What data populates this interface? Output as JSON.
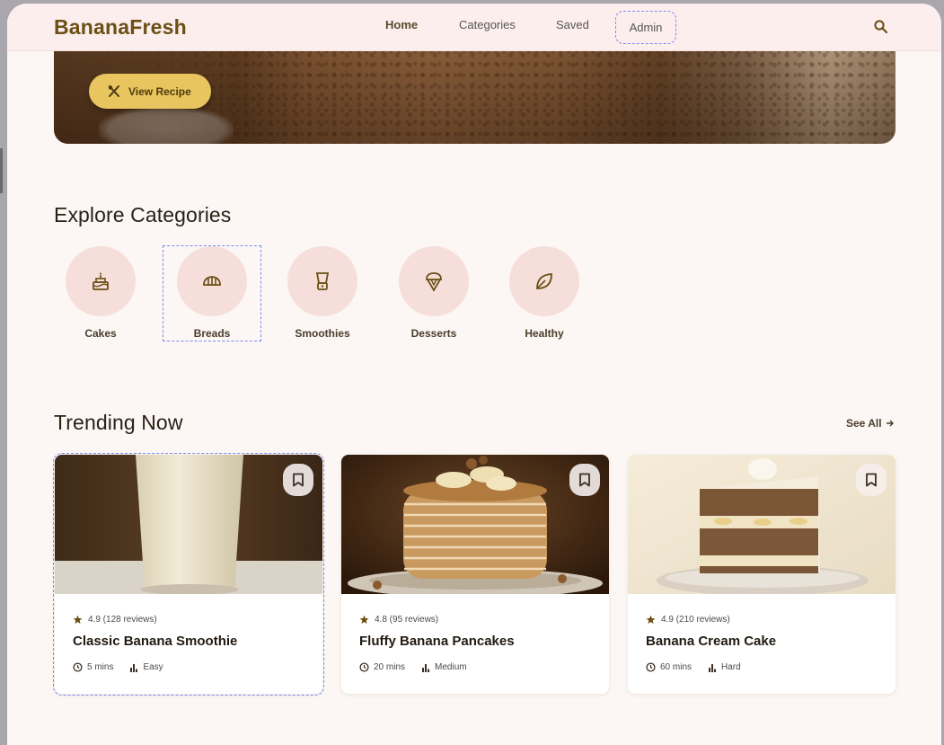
{
  "header": {
    "brand": "BananaFresh",
    "nav": [
      {
        "label": "Home",
        "active": true
      },
      {
        "label": "Categories",
        "active": false
      },
      {
        "label": "Saved",
        "active": false
      },
      {
        "label": "Admin",
        "active": false
      }
    ],
    "search_icon": "search-icon"
  },
  "hero": {
    "button_label": "View Recipe",
    "button_icon": "utensils-icon"
  },
  "categories": {
    "heading": "Explore Categories",
    "items": [
      {
        "label": "Cakes",
        "icon": "cake-icon"
      },
      {
        "label": "Breads",
        "icon": "croissant-icon"
      },
      {
        "label": "Smoothies",
        "icon": "blender-icon"
      },
      {
        "label": "Desserts",
        "icon": "ice-cream-icon"
      },
      {
        "label": "Healthy",
        "icon": "leaf-icon"
      }
    ]
  },
  "trending": {
    "heading": "Trending Now",
    "see_all": "See All",
    "cards": [
      {
        "rating": "4.9 (128 reviews)",
        "title": "Classic Banana Smoothie",
        "time": "5 mins",
        "difficulty": "Easy"
      },
      {
        "rating": "4.8 (95 reviews)",
        "title": "Fluffy Banana Pancakes",
        "time": "20 mins",
        "difficulty": "Medium"
      },
      {
        "rating": "4.9 (210 reviews)",
        "title": "Banana Cream Cake",
        "time": "60 mins",
        "difficulty": "Hard"
      }
    ]
  },
  "colors": {
    "brand": "#6b4f14",
    "accent": "#e8c55e",
    "page_bg": "#fcf6f4",
    "category_circle": "#f6dfdb"
  }
}
